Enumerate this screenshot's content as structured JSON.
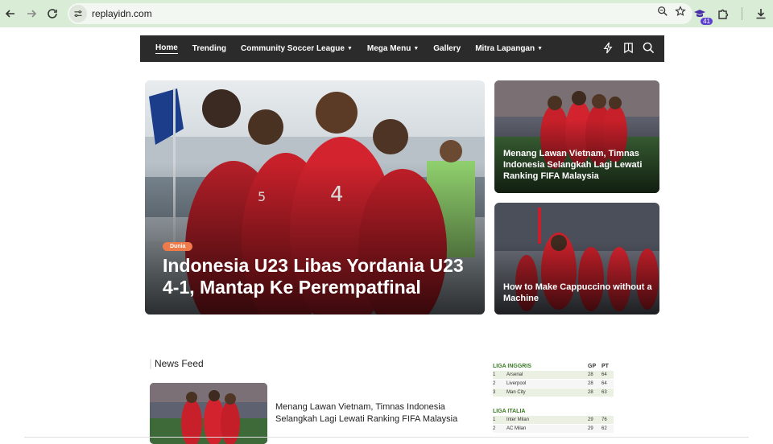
{
  "browser": {
    "url": "replayidn.com",
    "extension_count": "41"
  },
  "nav": {
    "items": [
      {
        "label": "Home",
        "caret": false,
        "active": true
      },
      {
        "label": "Trending",
        "caret": false
      },
      {
        "label": "Community Soccer League",
        "caret": true
      },
      {
        "label": "Mega Menu",
        "caret": true
      },
      {
        "label": "Gallery",
        "caret": false
      },
      {
        "label": "Mitra Lapangan",
        "caret": true
      }
    ],
    "icons": [
      "bolt-icon",
      "bookmark-icon",
      "search-icon"
    ]
  },
  "hero": {
    "main": {
      "badge": "Dunia",
      "title": "Indonesia U23 Libas Yordania U23 4-1, Mantap Ke Perempatfinal"
    },
    "side_top": {
      "title": "Menang Lawan Vietnam, Timnas Indonesia Selangkah Lagi Lewati Ranking FIFA Malaysia"
    },
    "side_bottom": {
      "title": "How to Make Cappuccino without a Machine"
    }
  },
  "feed": {
    "heading": "News Feed",
    "items": [
      {
        "title": "Menang Lawan Vietnam, Timnas Indonesia Selangkah Lagi Lewati Ranking FIFA Malaysia"
      }
    ]
  },
  "leagues": [
    {
      "name": "LIGA INGGRIS",
      "gp_label": "GP",
      "pt_label": "PT",
      "rows": [
        {
          "pos": "1",
          "team": "Arsenal",
          "gp": "28",
          "pt": "64"
        },
        {
          "pos": "2",
          "team": "Liverpool",
          "gp": "28",
          "pt": "64"
        },
        {
          "pos": "3",
          "team": "Man City",
          "gp": "28",
          "pt": "63"
        }
      ]
    },
    {
      "name": "LIGA ITALIA",
      "gp_label": "",
      "pt_label": "",
      "rows": [
        {
          "pos": "1",
          "team": "Inter Milan",
          "gp": "29",
          "pt": "76"
        },
        {
          "pos": "2",
          "team": "AC Milan",
          "gp": "29",
          "pt": "62"
        }
      ]
    }
  ],
  "colors": {
    "chrome_bg": "#d9ecd6",
    "nav_bg": "#2b2b2b",
    "badge": "#f07b4a",
    "league_title": "#3a7a23",
    "jersey_red": "#c8202a"
  }
}
